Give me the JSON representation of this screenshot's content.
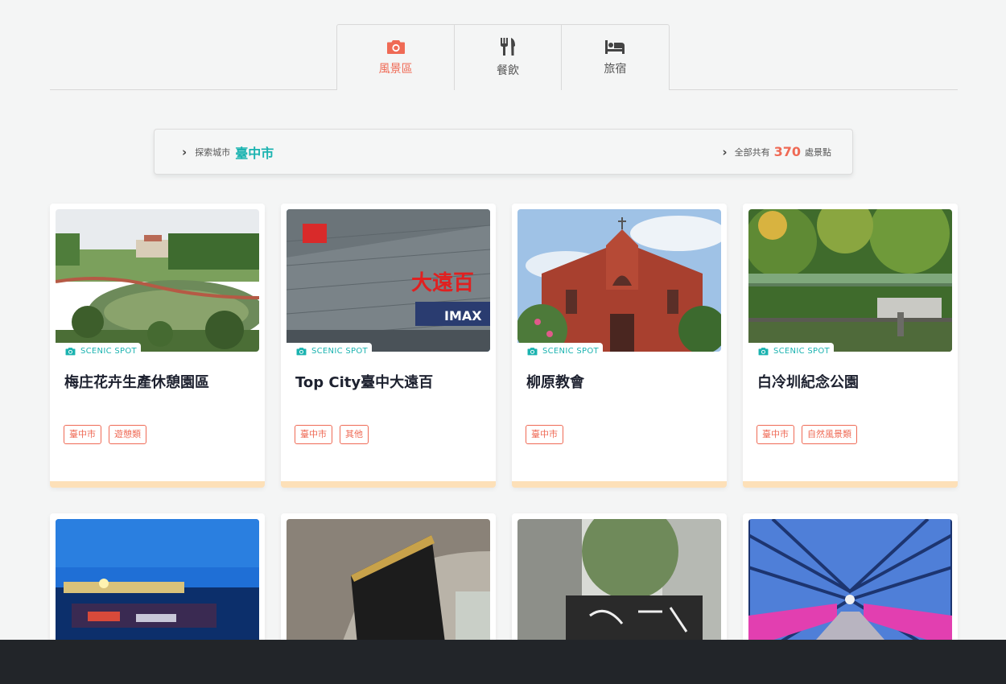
{
  "tabs": [
    {
      "label": "風景區",
      "icon": "camera-icon",
      "active": true
    },
    {
      "label": "餐飲",
      "icon": "utensils-icon",
      "active": false
    },
    {
      "label": "旅宿",
      "icon": "bed-icon",
      "active": false
    }
  ],
  "info": {
    "explore_label": "探索城市",
    "city": "臺中市",
    "total_prefix": "全部共有",
    "total_count": "370",
    "total_suffix": "處景點"
  },
  "badge_label": "SCENIC SPOT",
  "cards": [
    {
      "title": "梅庄花卉生產休憩園區",
      "tags": [
        "臺中市",
        "遊憩類"
      ]
    },
    {
      "title": "Top City臺中大遠百",
      "tags": [
        "臺中市",
        "其他"
      ],
      "photo_text": [
        "大遠百",
        "IMAX"
      ]
    },
    {
      "title": "柳原教會",
      "tags": [
        "臺中市"
      ]
    },
    {
      "title": "白冷圳紀念公園",
      "tags": [
        "臺中市",
        "自然風景類"
      ]
    }
  ],
  "colors": {
    "accent": "#ef6a55",
    "teal": "#1bb3b0",
    "card_bottom": "#fde0b8",
    "footer": "#222529"
  }
}
